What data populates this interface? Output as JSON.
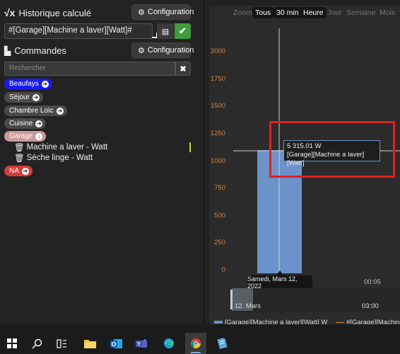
{
  "left_panel": {
    "title": "Historique calculé",
    "config_label": "Configuration",
    "formula_value": "#[Garage][Machine a laver][Watt]#",
    "commands_title": "Commandes",
    "config_label_2": "Configuration",
    "search_placeholder": "Rechercher",
    "tags": [
      {
        "label": "Beaufays",
        "color": "#1a1af0",
        "arrow": "➔"
      },
      {
        "label": "Séjour",
        "color": "#4a4a4a",
        "arrow": "➔"
      },
      {
        "label": "Chambre Loïc",
        "color": "#4a4a4a",
        "arrow": "➔"
      },
      {
        "label": "Cuisine",
        "color": "#4a4a4a",
        "arrow": "➔"
      },
      {
        "label": "Garage",
        "color": "#c89a9a",
        "arrow": "↓"
      },
      {
        "label": "NA",
        "color": "#d43c3c",
        "arrow": "➔"
      }
    ],
    "garage_items": [
      "Machine a laver - Watt",
      "Sèche linge - Watt"
    ]
  },
  "chart": {
    "zoom_label": "Zoom",
    "zoom_buttons": [
      "Tous",
      "30 min",
      "Heure",
      "Jour",
      "Semaine",
      "Mois"
    ],
    "zoom_selected": [
      "Tous",
      "30 min",
      "Heure"
    ],
    "tooltip_value": "5 315.01 W",
    "tooltip_series": "[Garage][Machine a laver][Watt]",
    "x_tooltip": "Samedi, Mars 12, 2022",
    "x_tick": "00:05",
    "navigator_start": "12. Mars",
    "navigator_tick": "03:00",
    "legend": [
      "[Garage][Machine a laver][Watt] W",
      "#[Garage][Machine"
    ],
    "legend_colors": [
      "#6b93c9",
      "#c8874a"
    ],
    "highlight_color": "#e02020"
  },
  "chart_data": {
    "type": "bar",
    "categories": [
      "Samedi, Mars 12, 2022"
    ],
    "series": [
      {
        "name": "[Garage][Machine a laver][Watt] W",
        "values": [
          1100
        ]
      },
      {
        "name": "#[Garage][Machine",
        "values": [
          1100
        ]
      }
    ],
    "ylim": [
      0,
      2000
    ],
    "yticks": [
      "0",
      "250",
      "500",
      "750",
      "1000",
      "1250",
      "1500",
      "1750",
      "2000"
    ]
  },
  "taskbar": {
    "icons": [
      "windows-start-icon",
      "search-icon",
      "task-view-icon",
      "file-explorer-icon",
      "outlook-icon",
      "teams-icon",
      "edge-icon",
      "chrome-icon",
      "notepad-icon"
    ]
  }
}
